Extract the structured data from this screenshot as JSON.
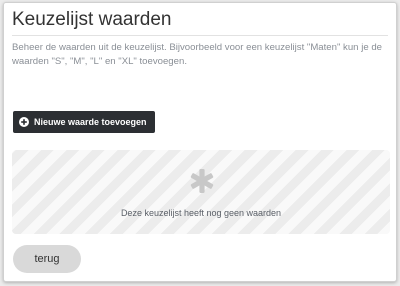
{
  "page": {
    "title": "Keuzelijst waarden",
    "description": "Beheer de waarden uit de keuzelijst. Bijvoorbeeld voor een keuzelijst \"Maten\" kun je de waarden \"S\", \"M\", \"L\" en \"XL\" toevoegen."
  },
  "actions": {
    "add_value_label": "Nieuwe waarde toevoegen",
    "add_value_icon": "plus-circle-icon",
    "back_label": "terug"
  },
  "empty_state": {
    "icon": "asterisk-icon",
    "message": "Deze keuzelijst heeft nog geen waarden"
  },
  "colors": {
    "primary_button": "#2c2f33",
    "secondary_button": "#d9d9d9",
    "placeholder_stripe_light": "#f9f9f9",
    "placeholder_stripe_dark": "#ececec",
    "icon_gray": "#c8c8c8"
  }
}
